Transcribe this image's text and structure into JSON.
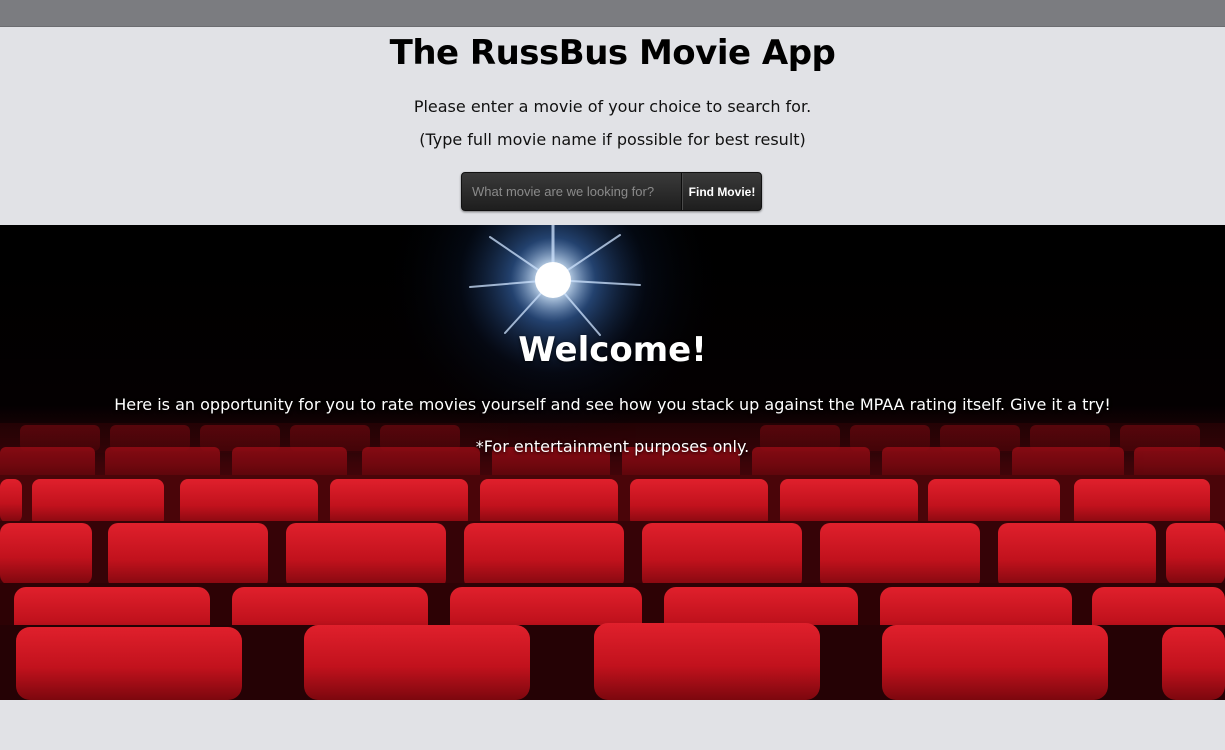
{
  "header": {
    "title": "The RussBus Movie App",
    "instruction_line1": "Please enter a movie of your choice to search for.",
    "instruction_line2": "(Type full movie name if possible for best result)"
  },
  "search": {
    "placeholder": "What movie are we looking for?",
    "value": "",
    "button_label": "Find Movie!"
  },
  "hero": {
    "heading": "Welcome!",
    "text1": "Here is an opportunity for you to rate movies yourself and see how you stack up against the MPAA rating itself. Give it a try!",
    "text2": "*For entertainment purposes only.",
    "image": "theater-seats-projector-image"
  },
  "colors": {
    "topbar": "#7b7c80",
    "page_background": "#e1e2e6",
    "seat_red": "#c8101c",
    "search_bar": "#2a2a2a"
  }
}
